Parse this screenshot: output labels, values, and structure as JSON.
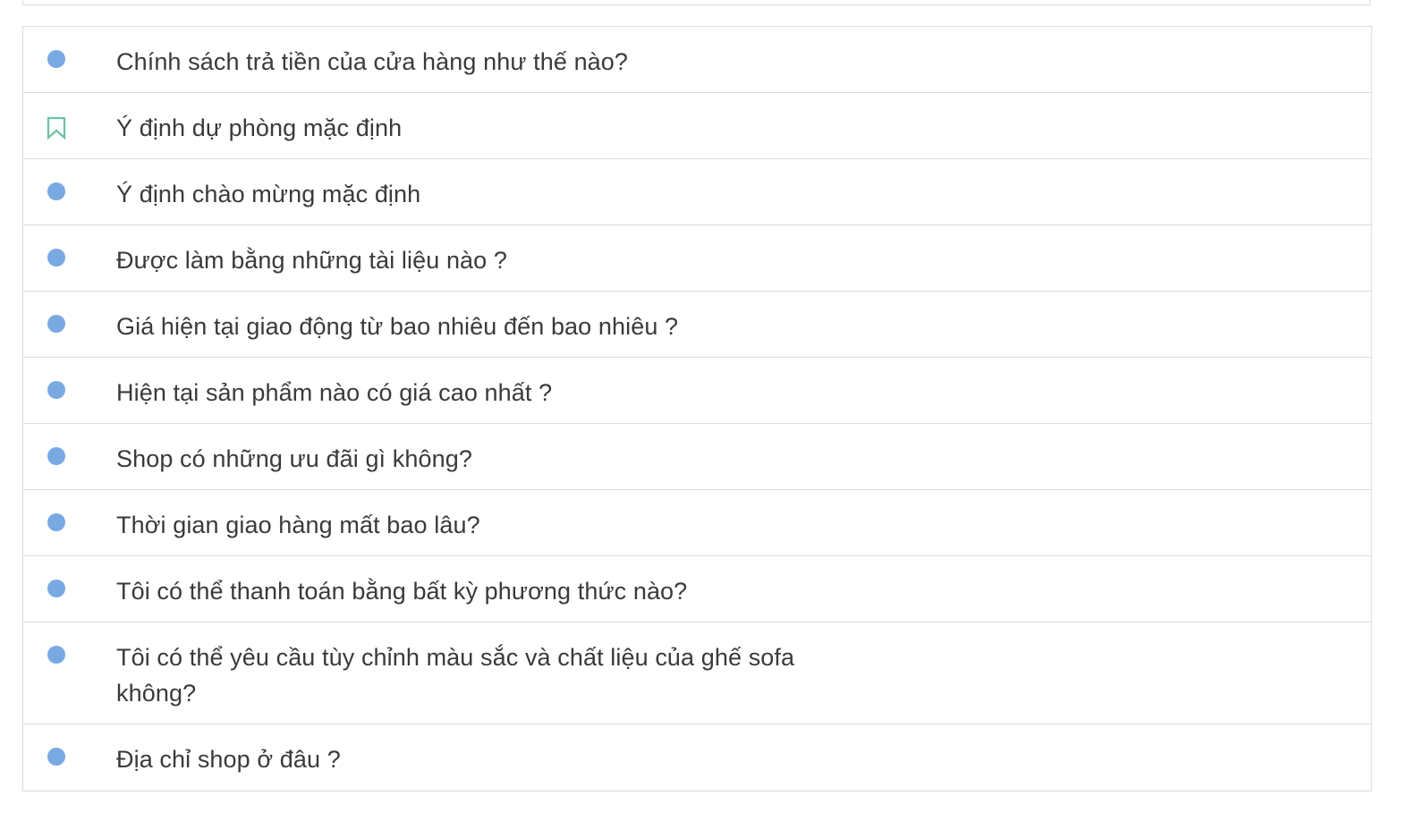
{
  "intents": [
    {
      "label": "Chính sách trả tiền của cửa hàng như thế nào?",
      "icon": "circle-dot-icon"
    },
    {
      "label": "Ý định dự phòng mặc định",
      "icon": "bookmark-icon"
    },
    {
      "label": "Ý định chào mừng mặc định",
      "icon": "circle-dot-icon"
    },
    {
      "label": "Được làm bằng những tài liệu nào ?",
      "icon": "circle-dot-icon"
    },
    {
      "label": "Giá hiện tại giao động từ bao nhiêu đến bao nhiêu ?",
      "icon": "circle-dot-icon"
    },
    {
      "label": "Hiện tại sản phẩm nào có giá cao nhất ?",
      "icon": "circle-dot-icon"
    },
    {
      "label": "Shop có những ưu đãi gì không?",
      "icon": "circle-dot-icon"
    },
    {
      "label": "Thời gian giao hàng mất bao lâu?",
      "icon": "circle-dot-icon"
    },
    {
      "label": "Tôi có thể thanh toán bằng bất kỳ phương thức nào?",
      "icon": "circle-dot-icon"
    },
    {
      "label": "Tôi có thể yêu cầu tùy chỉnh màu sắc và chất liệu của ghế sofa không?",
      "icon": "circle-dot-icon"
    },
    {
      "label": "Địa chỉ shop ở đâu ?",
      "icon": "circle-dot-icon"
    }
  ],
  "colors": {
    "dot": "#79a9e3",
    "bookmark": "#6cc3a0",
    "border": "#dcdcdc",
    "text": "#3a3a3a"
  }
}
